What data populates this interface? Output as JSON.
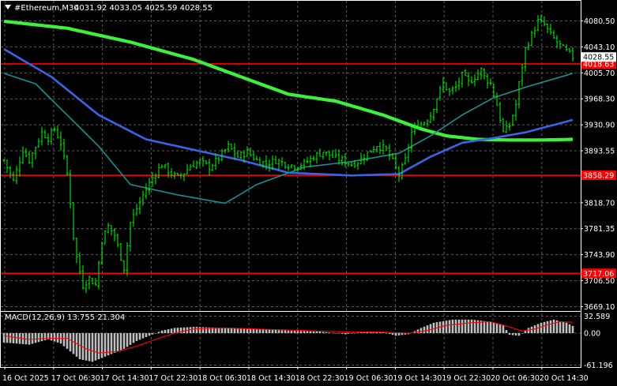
{
  "header": {
    "symbol": "#Ethereum,M30",
    "ohlc": "4031.92 4033.05 4025.59 4028.55"
  },
  "macd_panel": {
    "label": "MACD(12,26,9) 13.755 21.304"
  },
  "colors": {
    "background": "#000000",
    "grid": "#5a5a5a",
    "candle": "#00ff00",
    "ma_slow": "#3cf03c",
    "ma_mid": "#3a63e6",
    "ma_fast": "#1a9090",
    "level_line": "#ff0000",
    "macd_hist": "#c0c0c0",
    "macd_signal": "#ff0000"
  },
  "chart_data": [
    {
      "type": "candlestick",
      "title": "#Ethereum,M30",
      "ylim": [
        3669.1,
        4090
      ],
      "y_ticks": [
        "4080.50",
        "4043.10",
        "4005.70",
        "3968.30",
        "3930.90",
        "3893.55",
        "3818.70",
        "3781.35",
        "3743.90",
        "3706.50",
        "3669.10"
      ],
      "x_ticks": [
        "16 Oct 2025",
        "17 Oct 06:30",
        "17 Oct 14:30",
        "17 Oct 22:30",
        "18 Oct 06:30",
        "18 Oct 14:30",
        "18 Oct 22:30",
        "19 Oct 06:30",
        "19 Oct 14:30",
        "19 Oct 22:30",
        "20 Oct 06:30",
        "20 Oct 14:30"
      ],
      "current_price": {
        "label": "4028.55",
        "value": 4028.55
      },
      "horizontal_levels": [
        {
          "label": "4018.63",
          "value": 4018.63
        },
        {
          "label": "3858.29",
          "value": 3858.29
        },
        {
          "label": "3717.06",
          "value": 3717.06
        }
      ],
      "anchors": [
        [
          0,
          3880
        ],
        [
          3,
          3850
        ],
        [
          6,
          3895
        ],
        [
          8,
          3880
        ],
        [
          10,
          3900
        ],
        [
          12,
          3920
        ],
        [
          14,
          3912
        ],
        [
          16,
          3925
        ],
        [
          18,
          3905
        ],
        [
          20,
          3860
        ],
        [
          21,
          3820
        ],
        [
          22,
          3770
        ],
        [
          23,
          3740
        ],
        [
          25,
          3700
        ],
        [
          27,
          3710
        ],
        [
          29,
          3700
        ],
        [
          31,
          3765
        ],
        [
          33,
          3785
        ],
        [
          35,
          3772
        ],
        [
          37,
          3740
        ],
        [
          38,
          3725
        ],
        [
          40,
          3790
        ],
        [
          42,
          3810
        ],
        [
          44,
          3830
        ],
        [
          47,
          3855
        ],
        [
          50,
          3874
        ],
        [
          53,
          3860
        ],
        [
          55,
          3855
        ],
        [
          57,
          3862
        ],
        [
          59,
          3872
        ],
        [
          62,
          3878
        ],
        [
          65,
          3870
        ],
        [
          68,
          3883
        ],
        [
          71,
          3900
        ],
        [
          74,
          3885
        ],
        [
          77,
          3892
        ],
        [
          80,
          3880
        ],
        [
          83,
          3875
        ],
        [
          86,
          3880
        ],
        [
          89,
          3875
        ],
        [
          92,
          3872
        ],
        [
          95,
          3875
        ],
        [
          98,
          3885
        ],
        [
          101,
          3892
        ],
        [
          104,
          3885
        ],
        [
          107,
          3880
        ],
        [
          110,
          3874
        ],
        [
          112,
          3878
        ],
        [
          115,
          3890
        ],
        [
          118,
          3902
        ],
        [
          121,
          3895
        ],
        [
          123,
          3878
        ],
        [
          125,
          3858
        ],
        [
          127,
          3880
        ],
        [
          129,
          3920
        ],
        [
          131,
          3930
        ],
        [
          133,
          3935
        ],
        [
          135,
          3945
        ],
        [
          137,
          3970
        ],
        [
          139,
          3990
        ],
        [
          141,
          3978
        ],
        [
          143,
          3985
        ],
        [
          145,
          4002
        ],
        [
          147,
          3992
        ],
        [
          149,
          4000
        ],
        [
          151,
          4010
        ],
        [
          152,
          4000
        ],
        [
          154,
          3990
        ],
        [
          156,
          3960
        ],
        [
          158,
          3920
        ],
        [
          160,
          3930
        ],
        [
          162,
          3960
        ],
        [
          163,
          3990
        ],
        [
          165,
          4040
        ],
        [
          167,
          4060
        ],
        [
          169,
          4080
        ],
        [
          171,
          4075
        ],
        [
          173,
          4060
        ],
        [
          175,
          4050
        ],
        [
          177,
          4040
        ],
        [
          179,
          4033
        ],
        [
          180,
          4028.55
        ]
      ],
      "series": [
        {
          "name": "",
          "kind": "ma-slow",
          "values": [
            [
              0,
              4080
            ],
            [
              20,
              4070
            ],
            [
              40,
              4050
            ],
            [
              60,
              4025
            ],
            [
              75,
              4000
            ],
            [
              90,
              3975
            ],
            [
              105,
              3965
            ],
            [
              120,
              3945
            ],
            [
              132,
              3925
            ],
            [
              140,
              3915
            ],
            [
              150,
              3910
            ],
            [
              160,
              3909
            ],
            [
              170,
              3909
            ],
            [
              180,
              3910
            ]
          ]
        },
        {
          "name": "",
          "kind": "ma-mid",
          "values": [
            [
              0,
              4040
            ],
            [
              15,
              4000
            ],
            [
              30,
              3945
            ],
            [
              45,
              3910
            ],
            [
              60,
              3895
            ],
            [
              75,
              3880
            ],
            [
              90,
              3862
            ],
            [
              110,
              3858
            ],
            [
              125,
              3860
            ],
            [
              135,
              3885
            ],
            [
              145,
              3905
            ],
            [
              155,
              3912
            ],
            [
              165,
              3920
            ],
            [
              180,
              3938
            ]
          ]
        },
        {
          "name": "",
          "kind": "ma-fast",
          "values": [
            [
              0,
              4005
            ],
            [
              10,
              3990
            ],
            [
              20,
              3945
            ],
            [
              30,
              3900
            ],
            [
              40,
              3845
            ],
            [
              55,
              3830
            ],
            [
              70,
              3818
            ],
            [
              80,
              3845
            ],
            [
              95,
              3870
            ],
            [
              110,
              3878
            ],
            [
              125,
              3890
            ],
            [
              135,
              3915
            ],
            [
              145,
              3945
            ],
            [
              155,
              3970
            ],
            [
              165,
              3985
            ],
            [
              180,
              4005
            ]
          ]
        }
      ]
    },
    {
      "type": "bar",
      "title": "MACD(12,26,9)",
      "ylim": [
        -61.196,
        32.589
      ],
      "y_ticks": [
        "32.589",
        "0.00",
        "-61.196"
      ],
      "macd_value": 13.755,
      "signal_value": 21.304,
      "histogram": [
        [
          0,
          -18
        ],
        [
          8,
          -22
        ],
        [
          14,
          -12
        ],
        [
          18,
          -20
        ],
        [
          24,
          -50
        ],
        [
          28,
          -55
        ],
        [
          32,
          -45
        ],
        [
          38,
          -30
        ],
        [
          42,
          -15
        ],
        [
          46,
          -5
        ],
        [
          50,
          5
        ],
        [
          54,
          10
        ],
        [
          60,
          12
        ],
        [
          70,
          10
        ],
        [
          80,
          8
        ],
        [
          90,
          5
        ],
        [
          100,
          3
        ],
        [
          108,
          -2
        ],
        [
          115,
          3
        ],
        [
          120,
          2
        ],
        [
          124,
          -5
        ],
        [
          128,
          -2
        ],
        [
          132,
          10
        ],
        [
          136,
          20
        ],
        [
          142,
          26
        ],
        [
          148,
          26
        ],
        [
          154,
          22
        ],
        [
          158,
          15
        ],
        [
          160,
          -3
        ],
        [
          163,
          -5
        ],
        [
          166,
          10
        ],
        [
          170,
          20
        ],
        [
          174,
          26
        ],
        [
          178,
          20
        ],
        [
          180,
          14
        ]
      ],
      "signal": [
        [
          0,
          -5
        ],
        [
          8,
          -12
        ],
        [
          14,
          -10
        ],
        [
          20,
          -10
        ],
        [
          26,
          -30
        ],
        [
          30,
          -38
        ],
        [
          36,
          -35
        ],
        [
          42,
          -25
        ],
        [
          48,
          -12
        ],
        [
          54,
          0
        ],
        [
          60,
          8
        ],
        [
          70,
          10
        ],
        [
          80,
          8
        ],
        [
          90,
          6
        ],
        [
          100,
          4
        ],
        [
          110,
          2
        ],
        [
          120,
          2
        ],
        [
          128,
          0
        ],
        [
          134,
          5
        ],
        [
          140,
          15
        ],
        [
          148,
          20
        ],
        [
          154,
          22
        ],
        [
          160,
          12
        ],
        [
          164,
          4
        ],
        [
          168,
          8
        ],
        [
          172,
          16
        ],
        [
          176,
          22
        ],
        [
          180,
          21
        ]
      ]
    }
  ]
}
